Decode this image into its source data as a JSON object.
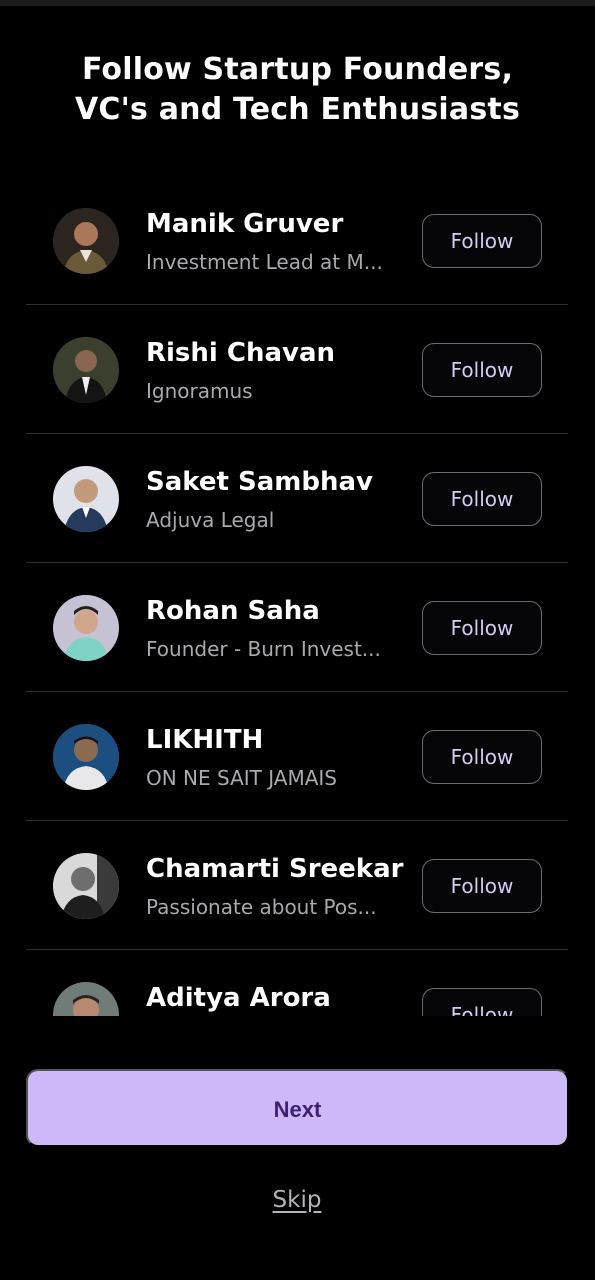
{
  "header": {
    "title_line1": "Follow Startup Founders,",
    "title_line2": "VC's and Tech Enthusiasts"
  },
  "people": [
    {
      "name": "Manik Gruver",
      "subtitle": "Investment Lead at M...",
      "button": "Follow",
      "avatar_color": "#6b4a36"
    },
    {
      "name": "Rishi Chavan",
      "subtitle": "Ignoramus",
      "button": "Follow",
      "avatar_color": "#2d3a2a"
    },
    {
      "name": "Saket Sambhav",
      "subtitle": "Adjuva Legal",
      "button": "Follow",
      "avatar_color": "#cfd2d8"
    },
    {
      "name": "Rohan Saha",
      "subtitle": "Founder - Burn Invest...",
      "button": "Follow",
      "avatar_color": "#b8b2c4"
    },
    {
      "name": "LIKHITH",
      "subtitle": "ON NE SAIT JAMAIS",
      "button": "Follow",
      "avatar_color": "#1f4e7a"
    },
    {
      "name": "Chamarti Sreekar",
      "subtitle": "Passionate about Pos...",
      "button": "Follow",
      "avatar_color": "#5a5a5a"
    },
    {
      "name": "Aditya Arora",
      "subtitle": "",
      "button": "Follow",
      "avatar_color": "#6f7c78"
    }
  ],
  "footer": {
    "next_label": "Next",
    "skip_label": "Skip"
  },
  "colors": {
    "background": "#000000",
    "accent": "#cdb9fa",
    "accent_text": "#3e1f73",
    "follow_text": "#d6ccf3"
  }
}
